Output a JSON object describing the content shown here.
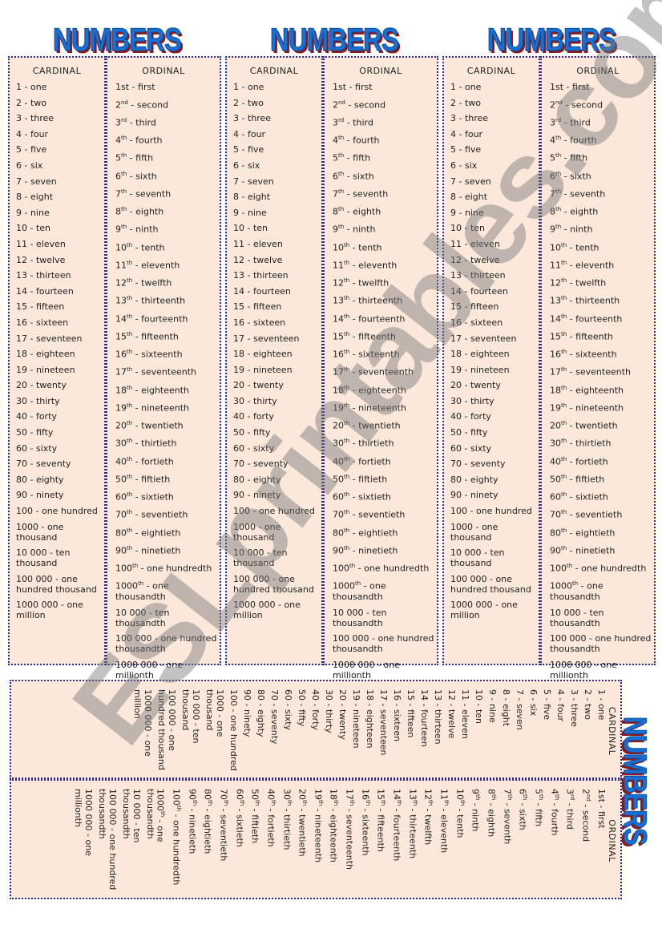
{
  "title": "NUMBERS",
  "cardinal_header": "CARDINAL",
  "ordinal_header": "ORDINAL",
  "watermark": "ESLprintables.com",
  "cardinal": [
    "1  - one",
    "2  - two",
    "3  - three",
    "4  - four",
    "5  - five",
    "6  - six",
    "7  - seven",
    "8  - eight",
    "9  - nine",
    "10  - ten",
    "11  - eleven",
    "12  - twelve",
    "13  - thirteen",
    "14  - fourteen",
    "15  - fifteen",
    "16  - sixteen",
    "17  - seventeen",
    "18  - eighteen",
    "19  - nineteen",
    "20  - twenty",
    "30  - thirty",
    "40  - forty",
    "50  - fifty",
    "60  - sixty",
    "70  - seventy",
    "80  - eighty",
    "90  - ninety",
    "100  - one hundred",
    "1000  - one thousand",
    "10 000 - ten thousand",
    "100 000 - one hundred thousand",
    "1000 000 - one million"
  ],
  "ordinal": [
    {
      "n": "1st",
      "sup": "",
      "w": "first"
    },
    {
      "n": "2",
      "sup": "nd",
      "w": "second"
    },
    {
      "n": "3",
      "sup": "rd",
      "w": "third"
    },
    {
      "n": "4",
      "sup": "th",
      "w": "fourth"
    },
    {
      "n": "5",
      "sup": "th",
      "w": "fifth"
    },
    {
      "n": "6",
      "sup": "th",
      "w": "sixth"
    },
    {
      "n": "7",
      "sup": "th",
      "w": "seventh"
    },
    {
      "n": "8",
      "sup": "th",
      "w": "eighth"
    },
    {
      "n": "9",
      "sup": "th",
      "w": "ninth"
    },
    {
      "n": "10",
      "sup": "th",
      "w": "tenth"
    },
    {
      "n": "11",
      "sup": "th",
      "w": "eleventh"
    },
    {
      "n": "12",
      "sup": "th",
      "w": "twelfth"
    },
    {
      "n": "13",
      "sup": "th",
      "w": "thirteenth"
    },
    {
      "n": "14",
      "sup": "th",
      "w": "fourteenth"
    },
    {
      "n": "15",
      "sup": "th",
      "w": "fifteenth"
    },
    {
      "n": "16",
      "sup": "th",
      "w": "sixteenth"
    },
    {
      "n": "17",
      "sup": "th",
      "w": "seventeenth"
    },
    {
      "n": "18",
      "sup": "th",
      "w": "eighteenth"
    },
    {
      "n": "19",
      "sup": "th",
      "w": "nineteenth"
    },
    {
      "n": "20",
      "sup": "th",
      "w": "twentieth"
    },
    {
      "n": "30",
      "sup": "th",
      "w": "thirtieth"
    },
    {
      "n": "40",
      "sup": "th",
      "w": "fortieth"
    },
    {
      "n": "50",
      "sup": "th",
      "w": "fiftieth"
    },
    {
      "n": "60",
      "sup": "th",
      "w": "sixtieth"
    },
    {
      "n": "70",
      "sup": "th",
      "w": "seventieth"
    },
    {
      "n": "80",
      "sup": "th",
      "w": "eightieth"
    },
    {
      "n": "90",
      "sup": "th",
      "w": "ninetieth"
    },
    {
      "n": "100",
      "sup": "th",
      "w": "one hundredth"
    },
    {
      "n": "1000",
      "sup": "th",
      "w": "one thousandth"
    },
    {
      "n": "10 000",
      "sup": "",
      "w": "ten thousandth"
    },
    {
      "n": "100 000",
      "sup": "",
      "w": "one hundred thousandth"
    },
    {
      "n": "1000 000",
      "sup": "",
      "w": "one millionth"
    }
  ],
  "colors": {
    "card_bg": "#fbe8da",
    "border": "#2b2b8a",
    "title_blue": "#1a6fd0",
    "title_shadow": "#8b1a1a"
  }
}
